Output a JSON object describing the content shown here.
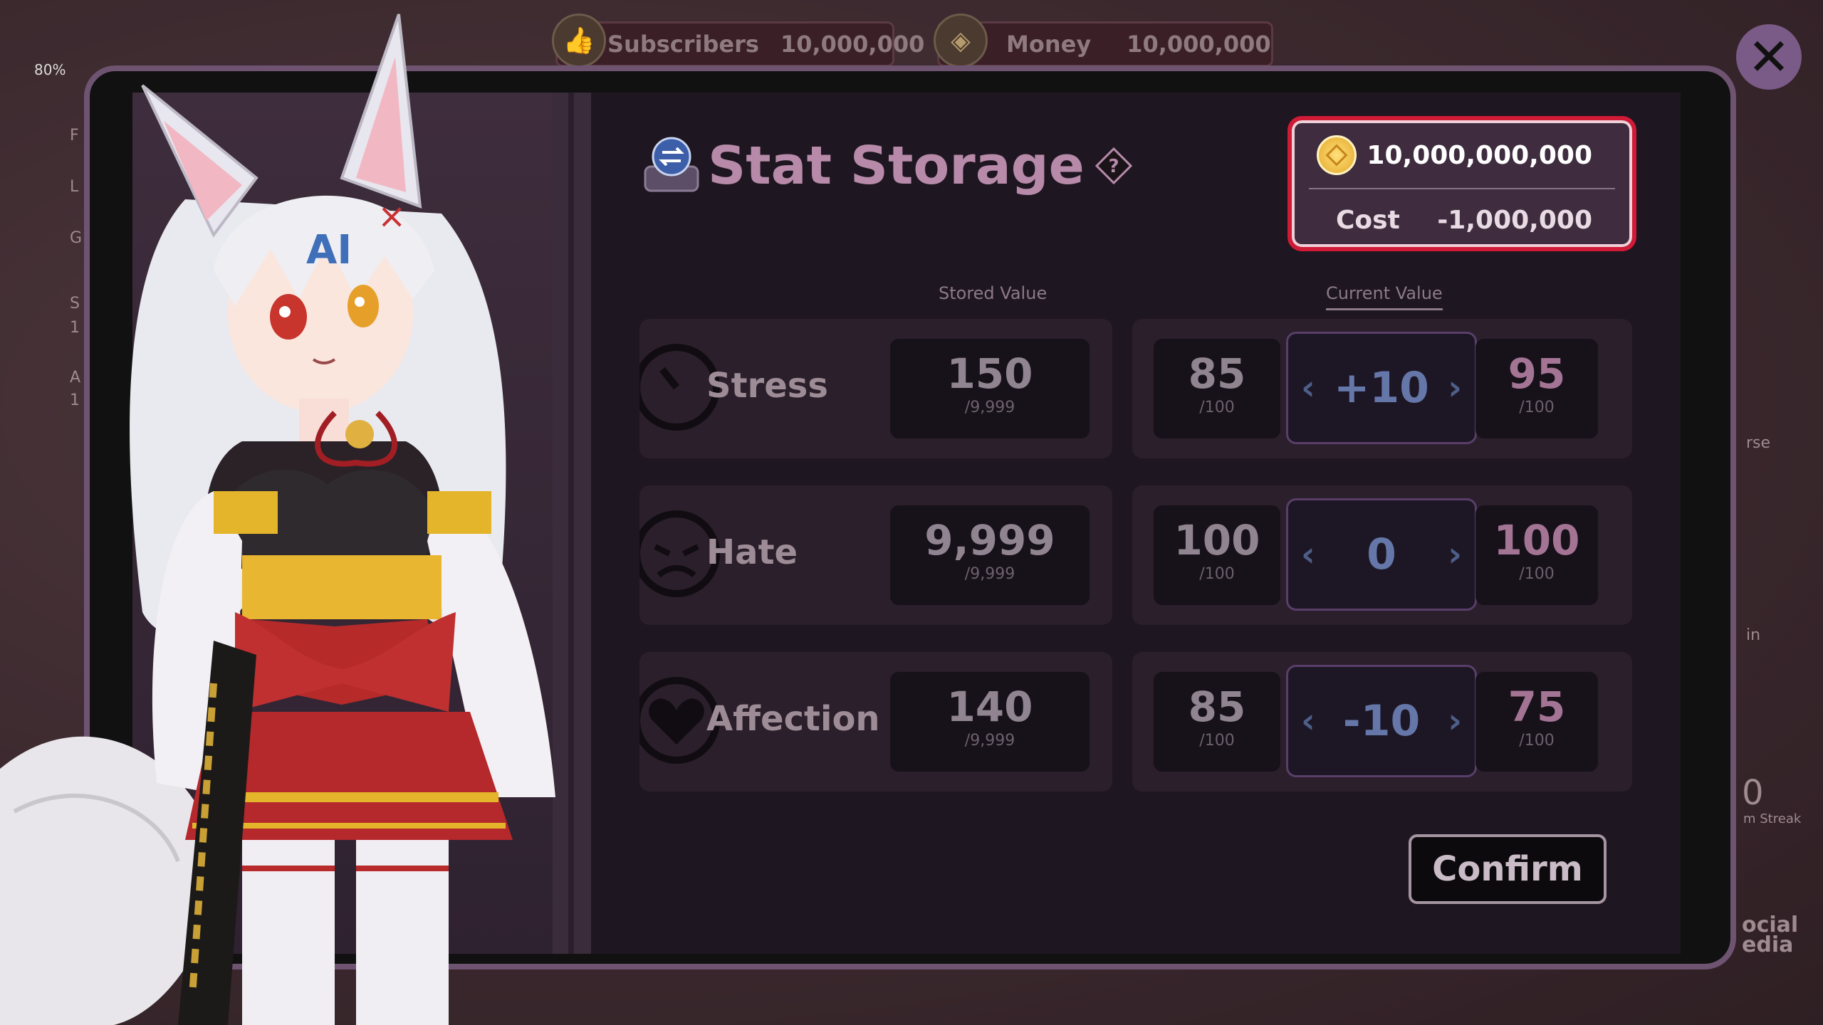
{
  "hud": {
    "subscribers_label": "Subscribers",
    "subscribers_value": "10,000,000",
    "money_label": "Money",
    "money_value": "10,000,000",
    "health_percent": "80%",
    "side_labels": [
      "F",
      "L",
      "G",
      "S",
      "A"
    ],
    "side_numbers": [
      "1",
      "1"
    ],
    "right_fragments": [
      "rse",
      "in",
      "0",
      "m Streak",
      "ocial",
      "edia"
    ]
  },
  "dialog": {
    "title": "Stat Storage",
    "close_icon": "close-icon",
    "balance": "10,000,000,000",
    "cost_label": "Cost",
    "cost_value": "-1,000,000",
    "stored_header": "Stored Value",
    "current_header": "Current Value",
    "confirm_label": "Confirm",
    "stats": [
      {
        "name": "Stress",
        "icon": "gauge-icon",
        "stored": "150",
        "stored_max": "/9,999",
        "current": "85",
        "current_max": "/100",
        "adjust": "+10",
        "result": "95",
        "result_max": "/100"
      },
      {
        "name": "Hate",
        "icon": "angry-face-icon",
        "stored": "9,999",
        "stored_max": "/9,999",
        "current": "100",
        "current_max": "/100",
        "adjust": "0",
        "result": "100",
        "result_max": "/100"
      },
      {
        "name": "Affection",
        "icon": "heart-icon",
        "stored": "140",
        "stored_max": "/9,999",
        "current": "85",
        "current_max": "/100",
        "adjust": "-10",
        "result": "75",
        "result_max": "/100"
      }
    ]
  },
  "colors": {
    "accent_pink": "#b68aa8",
    "highlight_red": "#d01a36",
    "adjust_blue": "#6576a8"
  }
}
